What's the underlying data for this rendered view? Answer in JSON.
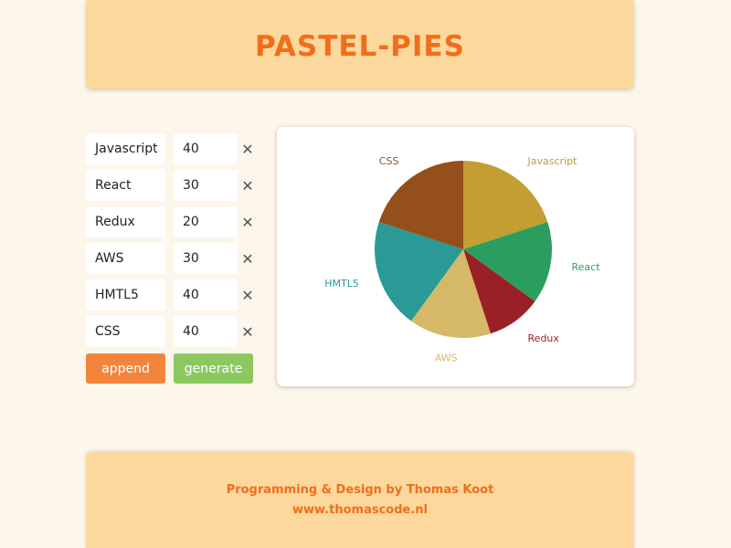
{
  "header": {
    "title": "PASTEL-PIES"
  },
  "entries": [
    {
      "name": "Javascript",
      "value": "40"
    },
    {
      "name": "React",
      "value": "30"
    },
    {
      "name": "Redux",
      "value": "20"
    },
    {
      "name": "AWS",
      "value": "30"
    },
    {
      "name": "HMTL5",
      "value": "40"
    },
    {
      "name": "CSS",
      "value": "40"
    }
  ],
  "buttons": {
    "remove_icon": "✕",
    "append_label": "append",
    "generate_label": "generate"
  },
  "chart_data": {
    "type": "pie",
    "slices": [
      {
        "label": "Javascript",
        "value": 40,
        "color": "#c39e33"
      },
      {
        "label": "React",
        "value": 30,
        "color": "#2b9e5f"
      },
      {
        "label": "Redux",
        "value": 20,
        "color": "#9a1f26"
      },
      {
        "label": "AWS",
        "value": 30,
        "color": "#d5b968"
      },
      {
        "label": "HMTL5",
        "value": 40,
        "color": "#2a9a97"
      },
      {
        "label": "CSS",
        "value": 40,
        "color": "#944f1b"
      }
    ],
    "start": "top",
    "direction": "clockwise"
  },
  "footer": {
    "credit": "Programming & Design by Thomas Koot",
    "site": "www.thomascode.nl"
  }
}
